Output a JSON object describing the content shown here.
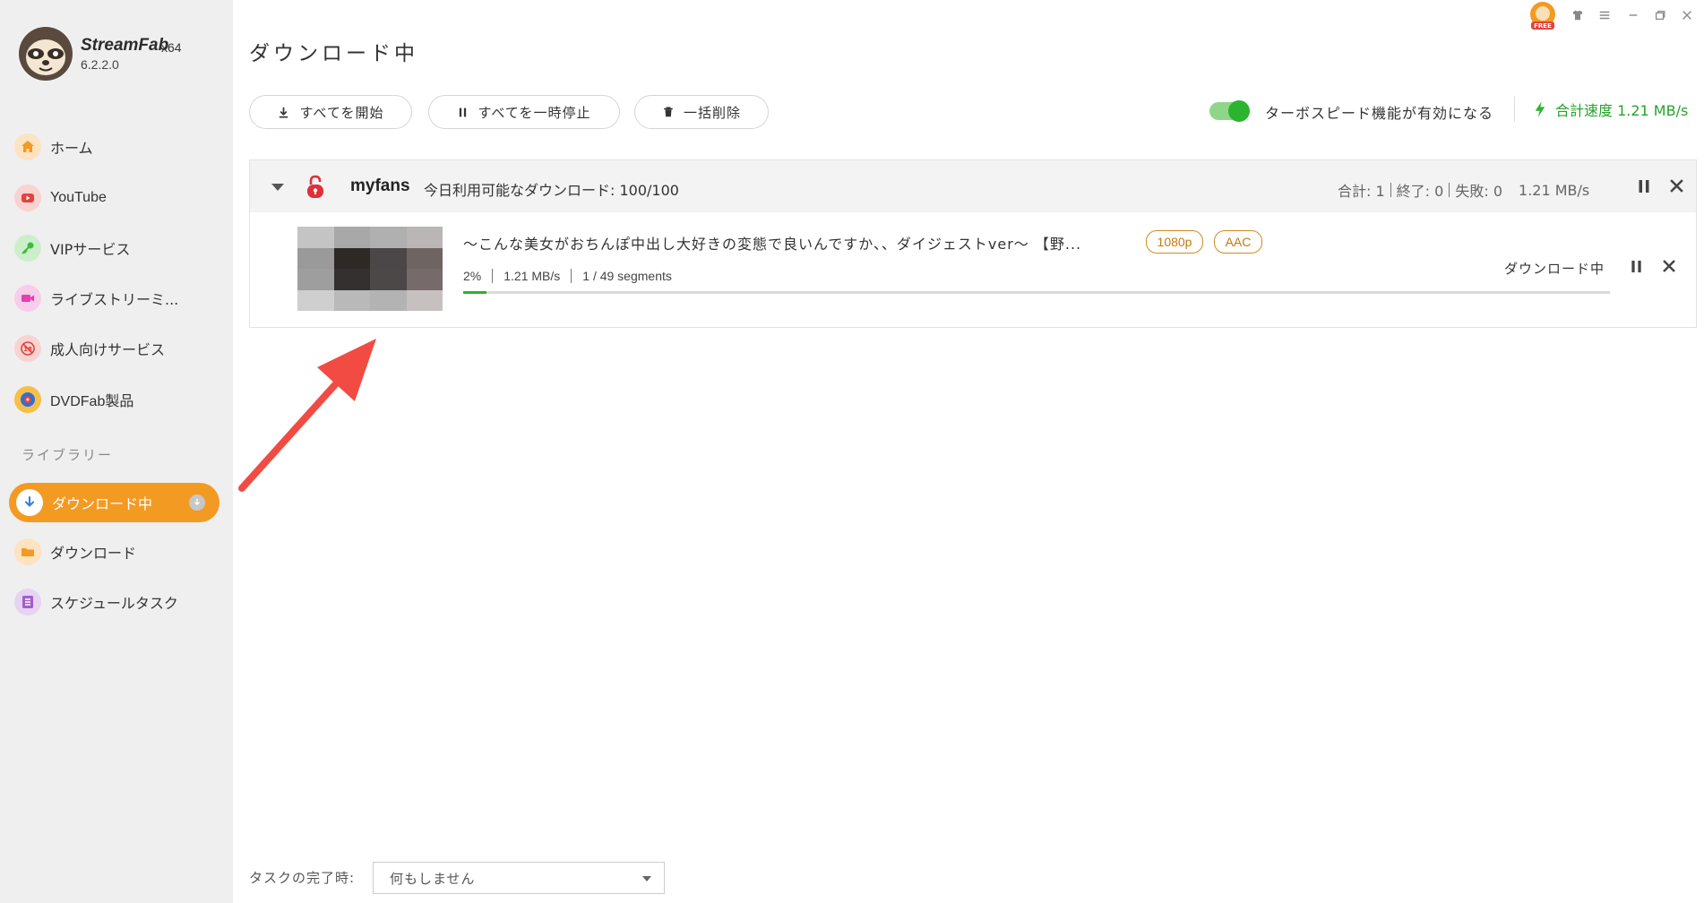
{
  "app": {
    "name": "StreamFab",
    "arch": "x64",
    "version": "6.2.2.0",
    "free_badge": "FREE"
  },
  "sidebar": {
    "items": [
      {
        "label": "ホーム",
        "icon": "home-icon",
        "color": "#f39a23",
        "bg": "#fde3c0"
      },
      {
        "label": "YouTube",
        "icon": "youtube-icon",
        "color": "#e0443e",
        "bg": "#f8d3d1"
      },
      {
        "label": "VIPサービス",
        "icon": "key-icon",
        "color": "#3dba3d",
        "bg": "#cdeecb"
      },
      {
        "label": "ライブストリーミ...",
        "icon": "video-camera-icon",
        "color": "#e63fb0",
        "bg": "#f8cdea"
      },
      {
        "label": "成人向けサービス",
        "icon": "adult-18-icon",
        "color": "#e0443e",
        "bg": "#f8d3d1"
      },
      {
        "label": "DVDFab製品",
        "icon": "dvdfab-icon",
        "color": "#2f6ed8",
        "bg": "#f4c04a"
      }
    ],
    "library_title": "ライブラリー",
    "library": [
      {
        "label": "ダウンロード中",
        "icon": "download-icon",
        "active": true
      },
      {
        "label": "ダウンロード",
        "icon": "folder-icon",
        "color": "#f39a23",
        "bg": "#fde3c0"
      },
      {
        "label": "スケジュールタスク",
        "icon": "schedule-list-icon",
        "color": "#a35fc9",
        "bg": "#e7d3f2"
      }
    ]
  },
  "main": {
    "title": "ダウンロード中",
    "buttons": {
      "start_all": "すべてを開始",
      "pause_all": "すべてを一時停止",
      "delete_all": "一括削除"
    },
    "turbo_label": "ターボスピード機能が有効になる",
    "turbo_on": true,
    "total_speed_label": "合計速度 1.21 MB/s"
  },
  "group": {
    "site": "myfans",
    "quota": "今日利用可能なダウンロード: 100/100",
    "total": "合計: 1",
    "finished": "終了: 0",
    "failed": "失敗: 0",
    "rate": "1.21 MB/s",
    "item": {
      "title": "〜こんな美女がおちんぽ中出し大好きの変態で良いんですか、、ダイジェストver〜 【野...",
      "tags": [
        "1080p",
        "AAC"
      ],
      "percent": "2%",
      "progress": 0.02,
      "speed": "1.21 MB/s",
      "segments": "1 / 49 segments",
      "status": "ダウンロード中"
    }
  },
  "footer": {
    "task_label": "タスクの完了時:",
    "task_value": "何もしません"
  },
  "colors": {
    "accent": "#f39a23",
    "green": "#2bb42e",
    "tag": "#c27a12",
    "arrow": "#f24b43"
  }
}
